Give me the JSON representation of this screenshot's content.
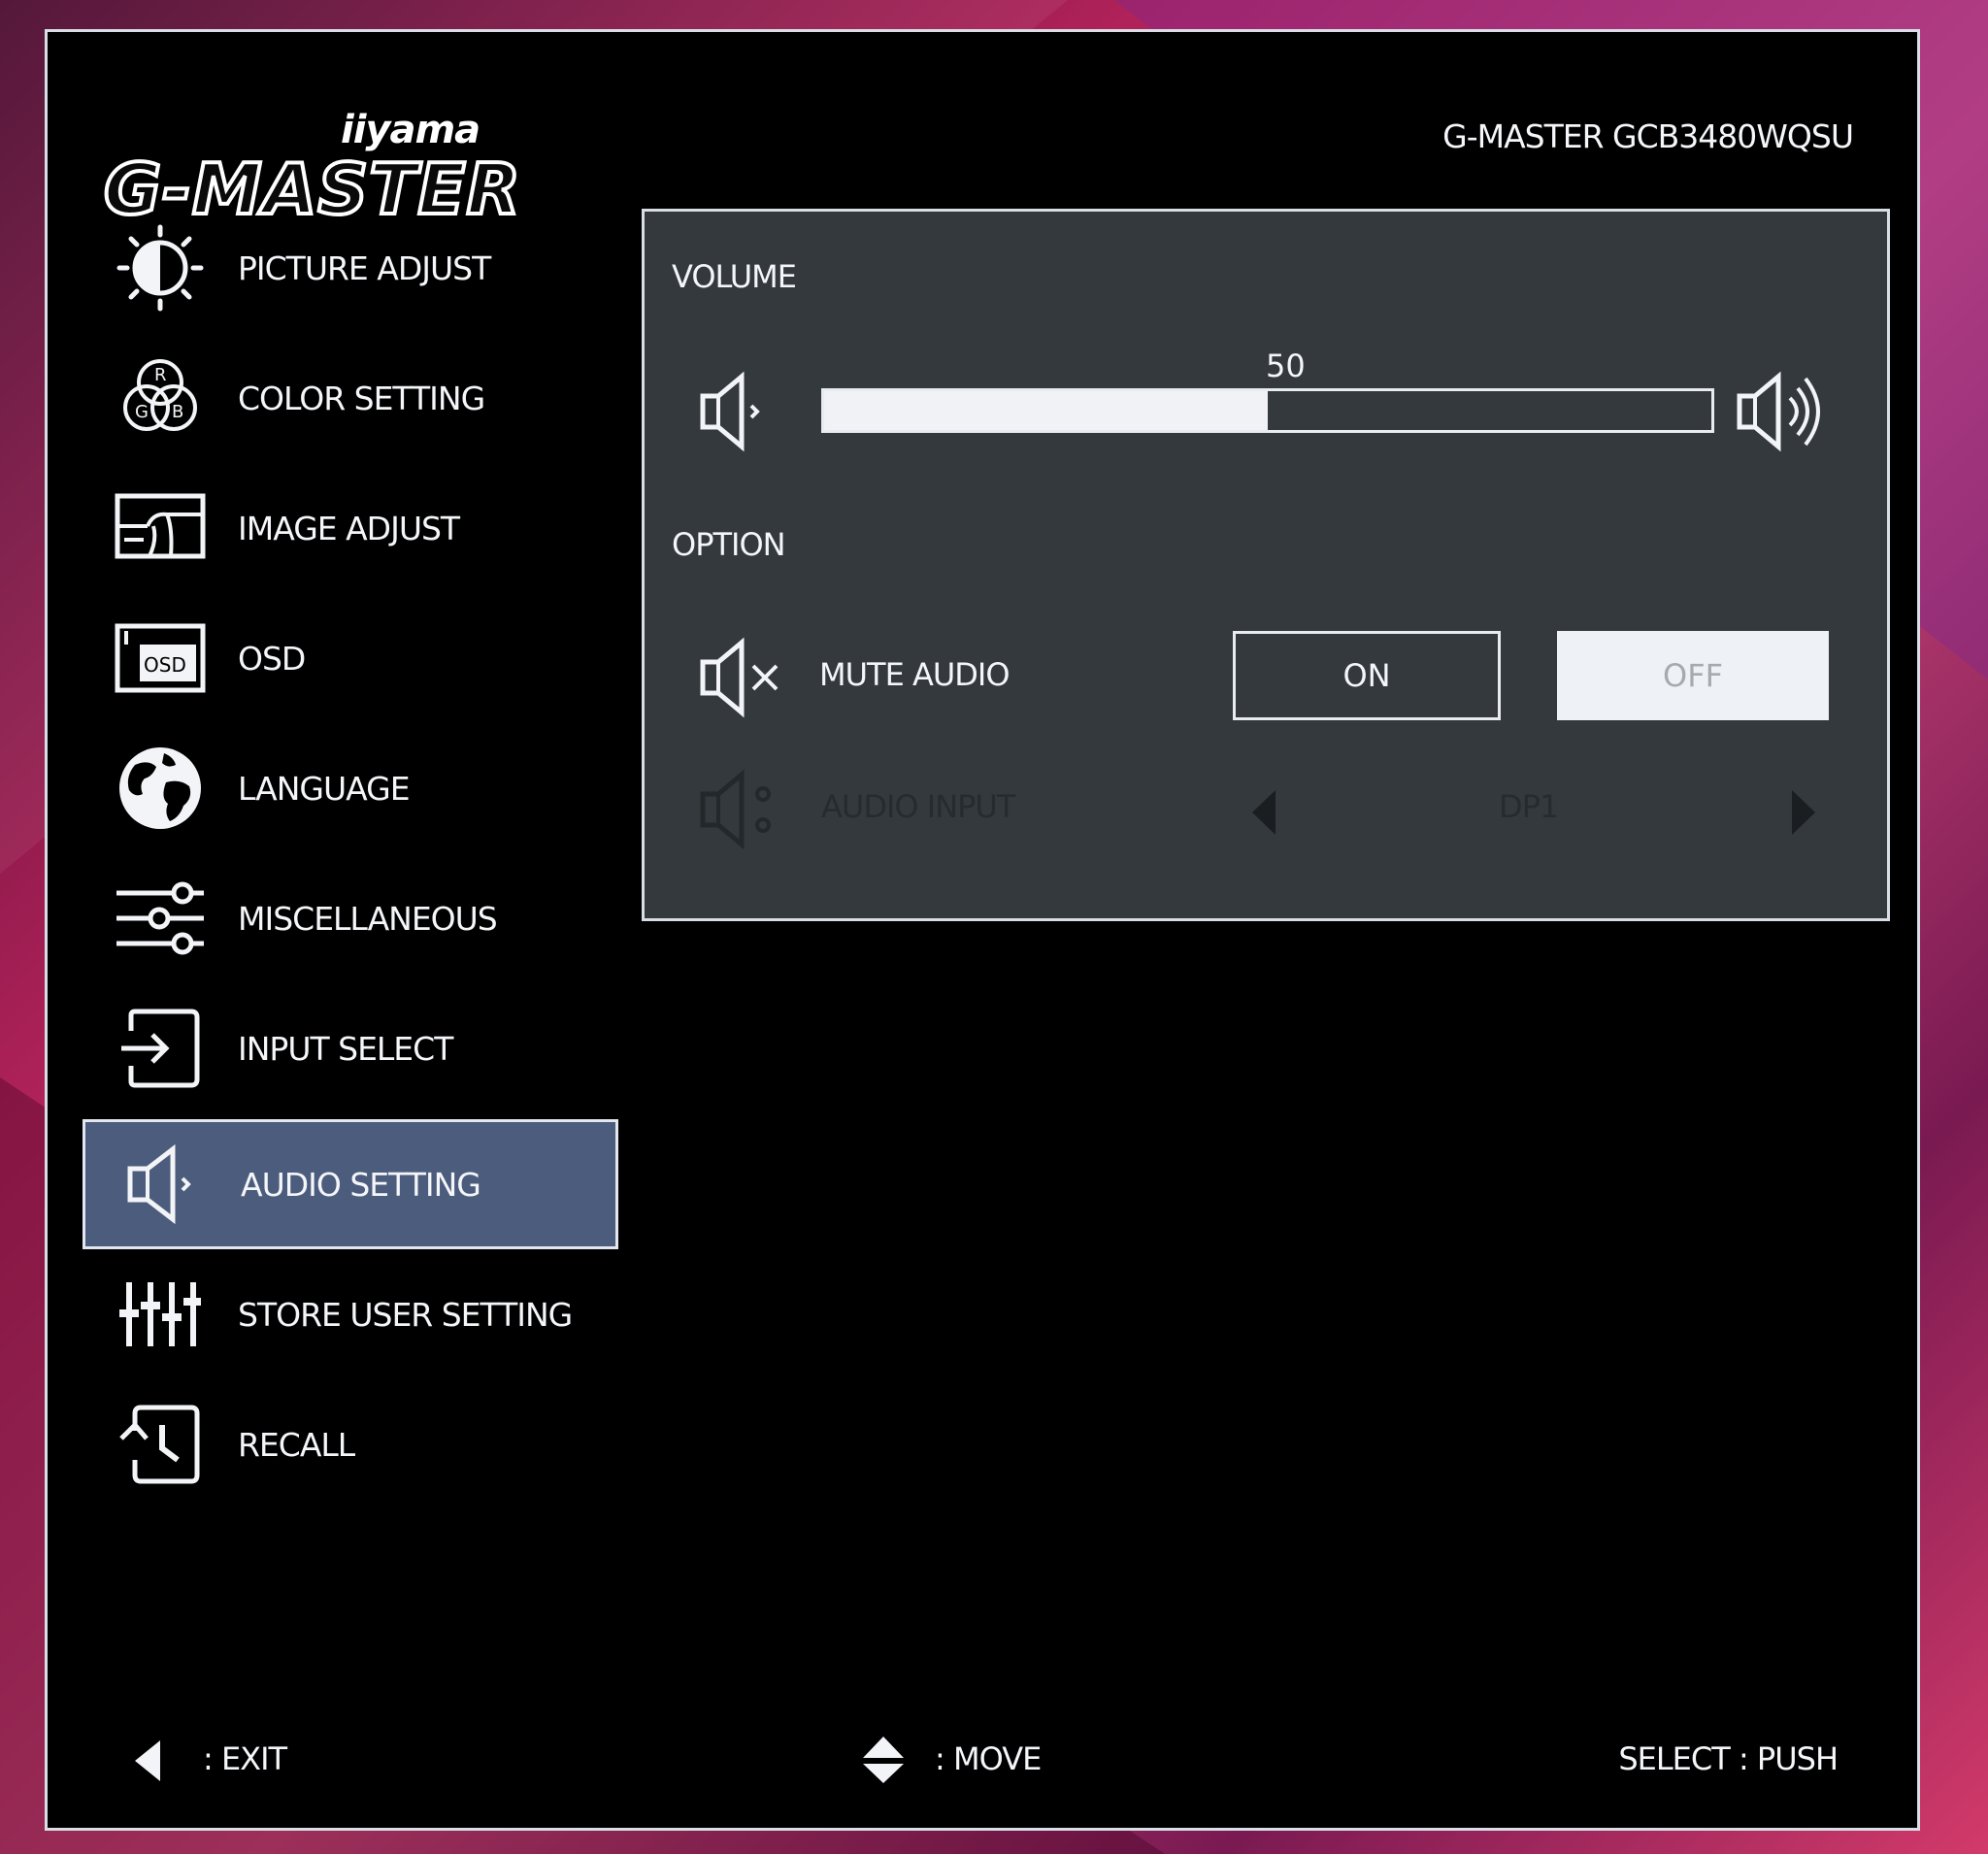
{
  "brand": {
    "small": "iiyama",
    "big": "G-MASTER",
    "model": "G-MASTER  GCB3480WQSU"
  },
  "menu": {
    "items": [
      {
        "label": "PICTURE ADJUST",
        "icon": "picture-adjust-icon"
      },
      {
        "label": "COLOR SETTING",
        "icon": "rgb-icon"
      },
      {
        "label": "IMAGE ADJUST",
        "icon": "image-adjust-icon"
      },
      {
        "label": "OSD",
        "icon": "osd-icon"
      },
      {
        "label": "LANGUAGE",
        "icon": "globe-icon"
      },
      {
        "label": "MISCELLANEOUS",
        "icon": "sliders-icon"
      },
      {
        "label": "INPUT SELECT",
        "icon": "input-icon"
      },
      {
        "label": "AUDIO SETTING",
        "icon": "speaker-icon",
        "active": true
      },
      {
        "label": "STORE USER SETTING",
        "icon": "equalizer-icon"
      },
      {
        "label": "RECALL",
        "icon": "recall-icon"
      }
    ]
  },
  "panel": {
    "volume": {
      "label": "VOLUME",
      "value": "50",
      "level": 50,
      "max": 100
    },
    "option": {
      "label": "OPTION"
    },
    "mute": {
      "label": "MUTE AUDIO",
      "on": "ON",
      "off": "OFF",
      "selected": "OFF"
    },
    "audio_input": {
      "label": "AUDIO INPUT",
      "value": "DP1",
      "disabled": true
    }
  },
  "footer": {
    "exit": ": EXIT",
    "move": ": MOVE",
    "select": "SELECT : PUSH"
  },
  "colors": {
    "osd_bg": "#000000",
    "panel_bg": "#33393d",
    "active_item": "#4c5c7d",
    "border": "#d8dde6"
  }
}
